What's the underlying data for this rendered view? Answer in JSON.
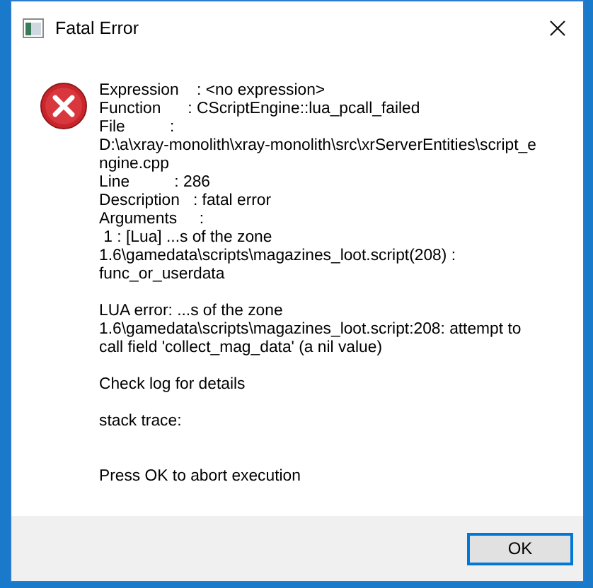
{
  "window": {
    "title": "Fatal Error"
  },
  "message": {
    "paragraphs": [
      [
        "Expression    : <no expression>",
        "Function      : CScriptEngine::lua_pcall_failed",
        "File          :",
        "D:\\a\\xray-monolith\\xray-monolith\\src\\xrServerEntities\\script_e",
        "ngine.cpp",
        "Line          : 286",
        "Description   : fatal error",
        "Arguments     :",
        " 1 : [Lua] ...s of the zone",
        "1.6\\gamedata\\scripts\\magazines_loot.script(208) :",
        "func_or_userdata"
      ],
      [
        "LUA error: ...s of the zone",
        "1.6\\gamedata\\scripts\\magazines_loot.script:208: attempt to",
        "call field 'collect_mag_data' (a nil value)"
      ],
      [
        "Check log for details"
      ],
      [
        "stack trace:"
      ],
      [
        "Press OK to abort execution"
      ]
    ]
  },
  "buttons": [
    "OK"
  ]
}
